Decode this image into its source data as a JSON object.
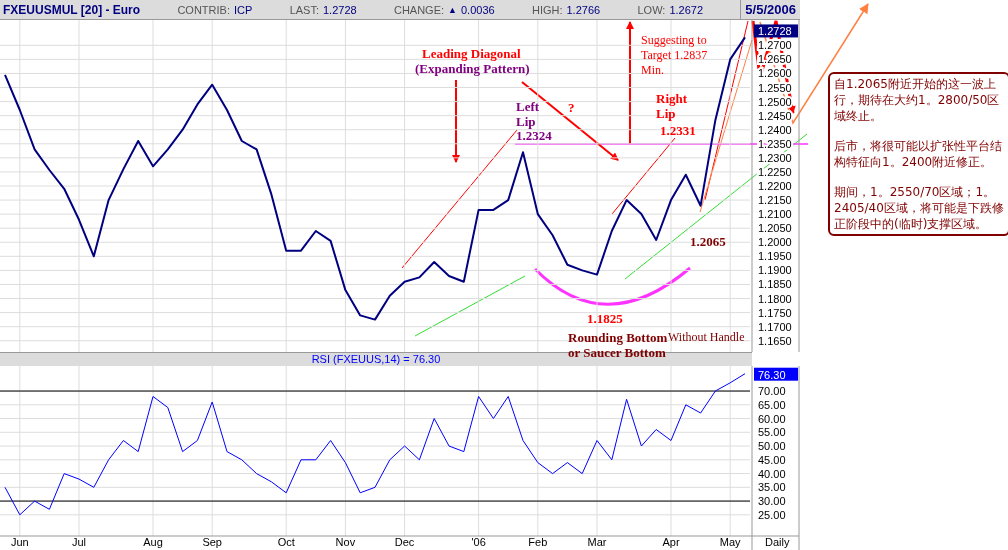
{
  "header": {
    "symbol": "FXEUUSMUL [20] - Euro",
    "fields": [
      {
        "label": "CONTRIB:",
        "value": "ICP"
      },
      {
        "label": "LAST:",
        "value": "1.2728"
      },
      {
        "label": "CHANGE:",
        "arrow": "▲",
        "value": "0.0036"
      },
      {
        "label": "HIGH:",
        "value": "1.2766"
      },
      {
        "label": "LOW:",
        "value": "1.2672"
      }
    ],
    "date": "5/5/2006"
  },
  "price_panel": {
    "last_tag": "1.2728",
    "chart_data": {
      "type": "line",
      "grid": true,
      "ylim": [
        1.161,
        1.279
      ],
      "yticks": [
        {
          "value": 1.165,
          "label": "1.1650"
        },
        {
          "value": 1.17,
          "label": "1.1700"
        },
        {
          "value": 1.175,
          "label": "1.1750"
        },
        {
          "value": 1.18,
          "label": "1.1800"
        },
        {
          "value": 1.185,
          "label": "1.1850"
        },
        {
          "value": 1.19,
          "label": "1.1900"
        },
        {
          "value": 1.195,
          "label": "1.1950"
        },
        {
          "value": 1.2,
          "label": "1.2000"
        },
        {
          "value": 1.205,
          "label": "1.2050"
        },
        {
          "value": 1.21,
          "label": "1.2100"
        },
        {
          "value": 1.215,
          "label": "1.2150"
        },
        {
          "value": 1.22,
          "label": "1.2200"
        },
        {
          "value": 1.225,
          "label": "1.2250"
        },
        {
          "value": 1.23,
          "label": "1.2300"
        },
        {
          "value": 1.235,
          "label": "1.2350"
        },
        {
          "value": 1.24,
          "label": "1.2400"
        },
        {
          "value": 1.245,
          "label": "1.2450"
        },
        {
          "value": 1.25,
          "label": "1.2500"
        },
        {
          "value": 1.255,
          "label": "1.2550"
        },
        {
          "value": 1.26,
          "label": "1.2600"
        },
        {
          "value": 1.265,
          "label": "1.2650"
        },
        {
          "value": 1.27,
          "label": "1.2700"
        }
      ],
      "series": [
        {
          "color": "#000080",
          "values": [
            1.2595,
            1.247,
            1.233,
            1.2257,
            1.219,
            1.208,
            1.195,
            1.215,
            1.226,
            1.236,
            1.227,
            1.233,
            1.24,
            1.249,
            1.256,
            1.247,
            1.236,
            1.233,
            1.217,
            1.197,
            1.197,
            1.204,
            1.2005,
            1.183,
            1.174,
            1.1725,
            1.181,
            1.186,
            1.1875,
            1.193,
            1.188,
            1.186,
            1.2115,
            1.2115,
            1.215,
            1.232,
            1.21,
            1.2025,
            1.192,
            1.19,
            1.1885,
            1.204,
            1.215,
            1.21,
            1.2008,
            1.215,
            1.224,
            1.213,
            1.2435,
            1.265,
            1.2728
          ]
        }
      ]
    }
  },
  "rsi_panel": {
    "value_tag": "76.30",
    "period": "Daily",
    "chart_data": {
      "type": "line",
      "title": "RSI (FXEUUS,14) = 76.30",
      "grid": true,
      "ylim": [
        17.3,
        79.1
      ],
      "categories": [
        null,
        "Jun",
        null,
        null,
        null,
        "Jul",
        null,
        null,
        null,
        null,
        "Aug",
        null,
        null,
        null,
        "Sep",
        null,
        null,
        null,
        null,
        "Oct",
        null,
        null,
        null,
        "Nov",
        null,
        null,
        null,
        "Dec",
        null,
        null,
        null,
        null,
        "'06",
        null,
        null,
        null,
        "Feb",
        null,
        null,
        null,
        "Mar",
        null,
        null,
        null,
        null,
        "Apr",
        null,
        null,
        null,
        "May",
        null
      ],
      "yticks": [
        {
          "value": 25,
          "label": "25.00"
        },
        {
          "value": 30,
          "label": "30.00"
        },
        {
          "value": 35,
          "label": "35.00"
        },
        {
          "value": 40,
          "label": "40.00"
        },
        {
          "value": 45,
          "label": "45.00"
        },
        {
          "value": 50,
          "label": "50.00"
        },
        {
          "value": 55,
          "label": "55.00"
        },
        {
          "value": 60,
          "label": "60.00"
        },
        {
          "value": 65,
          "label": "65.00"
        },
        {
          "value": 70,
          "label": "70.00"
        }
      ],
      "series": [
        {
          "color": "#0000ff",
          "values": [
            35,
            25,
            30,
            27,
            40,
            38,
            35,
            45,
            52,
            48,
            68,
            64,
            48,
            52,
            66,
            48,
            45,
            40,
            37,
            33,
            45,
            45,
            52,
            44,
            33,
            35,
            45,
            50,
            45,
            60,
            50,
            48,
            68,
            60,
            68,
            52,
            44,
            40,
            44,
            40,
            52,
            45,
            67,
            50,
            56,
            52,
            65,
            62,
            70,
            73,
            76.3
          ]
        }
      ]
    }
  },
  "annotations": [
    {
      "text": "Leading Diagonal",
      "color": "#ff0000",
      "bold": true
    },
    {
      "text": "(Expanding Pattern)",
      "color": "#800080",
      "bold": true
    },
    {
      "text": "Suggesting to\nTarget 1.2837\nMin.",
      "color": "#ff0000",
      "bold": false
    },
    {
      "text": "Left\nLip",
      "color": "#800080",
      "bold": true
    },
    {
      "text": "?",
      "color": "#ff0000",
      "bold": true
    },
    {
      "text": "Right\nLip",
      "color": "#ff0000",
      "bold": true
    },
    {
      "text": "1.2324",
      "color": "#800080",
      "bold": true
    },
    {
      "text": "1.2331",
      "color": "#ff0000",
      "bold": true
    },
    {
      "text": "1.2065",
      "color": "#800000",
      "bold": true
    },
    {
      "text": "1.1825",
      "color": "#ff0000",
      "bold": true
    },
    {
      "text": "Rounding Bottom\nor Saucer Bottom",
      "color": "#800000",
      "bold": true
    },
    {
      "text": "Without Handle",
      "color": "#800000",
      "bold": false
    }
  ],
  "commentary": {
    "paragraphs": [
      "自1.2065附近开始的这一波上行，期待在大约1。2800/50区域终止。",
      "后市，将很可能以扩张性平台结构特征向1。2400附近修正。",
      "期间，1。2550/70区域；1。2405/40区域，将可能是下跌修正阶段中的(临时)支撑区域。"
    ]
  }
}
